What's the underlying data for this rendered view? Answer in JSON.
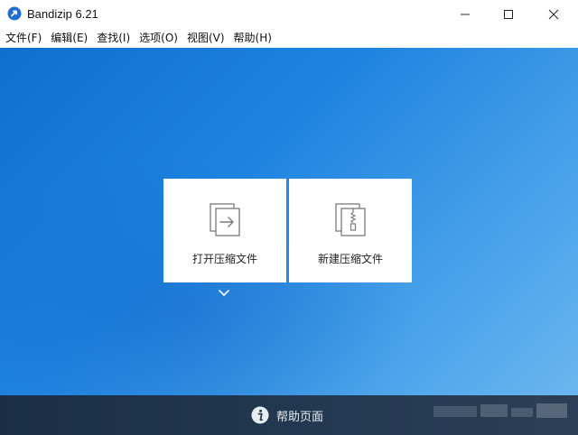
{
  "window": {
    "title": "Bandizip 6.21",
    "app_icon": "bandizip-logo-icon",
    "controls": [
      "minimize-icon",
      "maximize-icon",
      "close-icon"
    ]
  },
  "menu": {
    "items": [
      {
        "label": "文件(F)"
      },
      {
        "label": "编辑(E)"
      },
      {
        "label": "查找(I)"
      },
      {
        "label": "选项(O)"
      },
      {
        "label": "视图(V)"
      },
      {
        "label": "帮助(H)"
      }
    ]
  },
  "main": {
    "background_colors": [
      "#0f6fcf",
      "#6ab6ef"
    ],
    "cards": [
      {
        "label": "打开压缩文件",
        "icon": "open-archive-icon"
      },
      {
        "label": "新建压缩文件",
        "icon": "new-archive-icon"
      }
    ],
    "more_icon": "chevron-down-icon"
  },
  "footer": {
    "help_label": "帮助页面",
    "help_icon": "info-icon",
    "background_color": "#1a2f45"
  }
}
